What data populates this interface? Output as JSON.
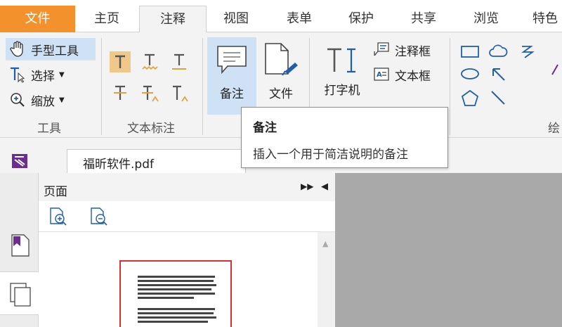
{
  "tabs": {
    "file": "文件",
    "home": "主页",
    "comment": "注释",
    "view": "视图",
    "form": "表单",
    "protect": "保护",
    "share": "共享",
    "browse": "浏览",
    "special": "特色"
  },
  "ribbon": {
    "tools": {
      "hand": "手型工具",
      "select": "选择",
      "zoom": "缩放",
      "group_label": "工具"
    },
    "text_markup": {
      "group_label": "文本标注"
    },
    "note": "备注",
    "file_attach": "文件",
    "typewriter": "打字机",
    "callout": "注释框",
    "textbox": "文本框",
    "drawing_group_label": "绘"
  },
  "tooltip": {
    "title": "备注",
    "description": "插入一个用于简洁说明的备注"
  },
  "document_tab": {
    "name": "福昕软件.pdf"
  },
  "panel": {
    "title": "页面"
  },
  "colors": {
    "file_tab": "#f3922d",
    "accent_blue": "#1f5fa8",
    "thumb_border": "#d63030",
    "logo_purple": "#6b2d8f"
  }
}
